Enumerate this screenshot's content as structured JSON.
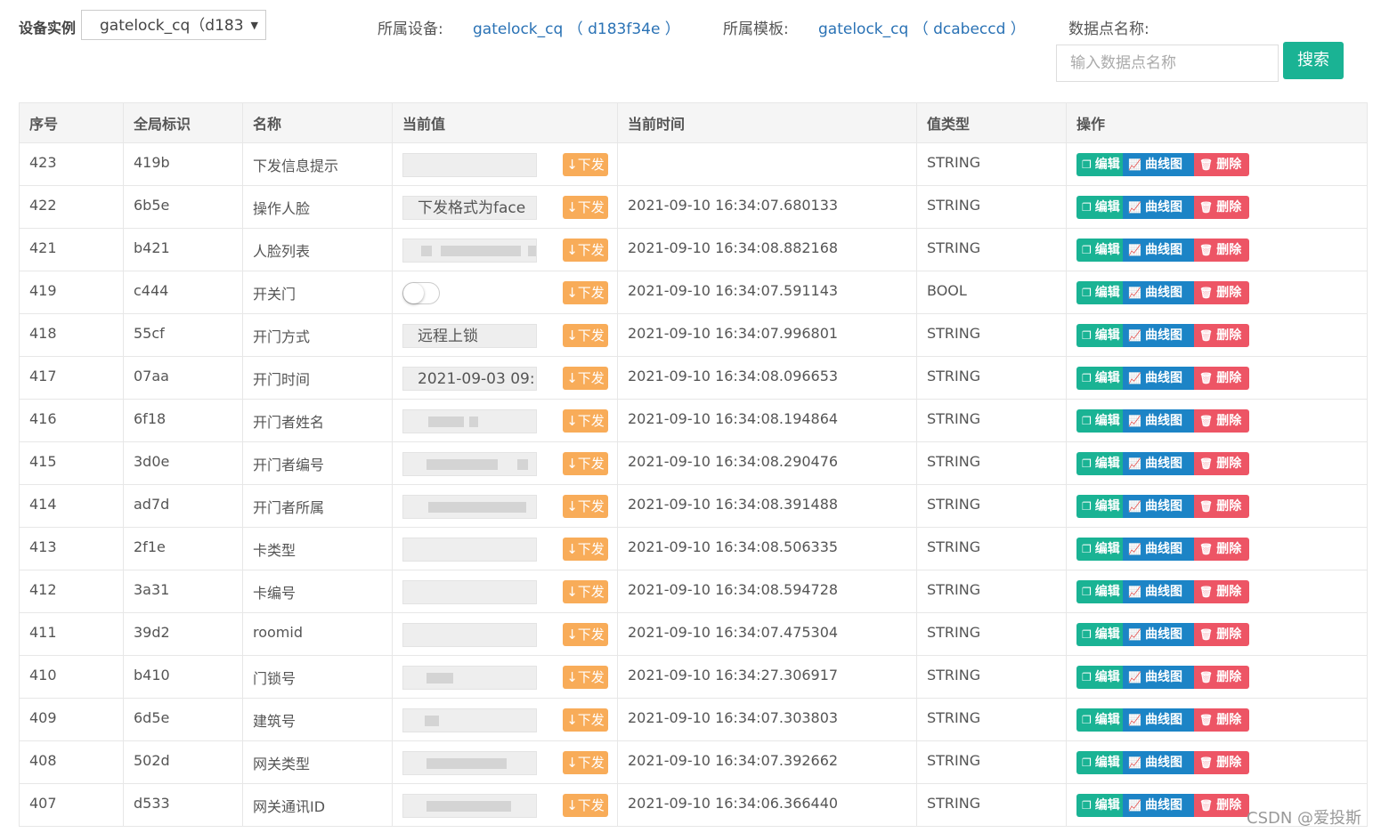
{
  "filters": {
    "instance_label": "设备实例",
    "instance_value": "gatelock_cq（d183",
    "device_label": "所属设备:",
    "device_value": "gatelock_cq （ d183f34e ）",
    "template_label": "所属模板:",
    "template_value": "gatelock_cq （ dcabeccd ）",
    "datapoint_label": "数据点名称:",
    "search_placeholder": "输入数据点名称",
    "search_button": "搜索"
  },
  "table": {
    "headers": [
      "序号",
      "全局标识",
      "名称",
      "当前值",
      "当前时间",
      "值类型",
      "操作"
    ],
    "send_label": "下发",
    "edit_label": "编辑",
    "chart_label": "曲线图",
    "delete_label": "删除",
    "rows": [
      {
        "no": "423",
        "gid": "419b",
        "name": "下发信息提示",
        "value": "",
        "time": "",
        "type": "STRING"
      },
      {
        "no": "422",
        "gid": "6b5e",
        "name": "操作人脸",
        "value": "下发格式为face",
        "time": "2021-09-10 16:34:07.680133",
        "type": "STRING"
      },
      {
        "no": "421",
        "gid": "b421",
        "name": "人脸列表",
        "value": "",
        "time": "2021-09-10 16:34:08.882168",
        "type": "STRING"
      },
      {
        "no": "419",
        "gid": "c444",
        "name": "开关门",
        "value": "",
        "time": "2021-09-10 16:34:07.591143",
        "type": "BOOL"
      },
      {
        "no": "418",
        "gid": "55cf",
        "name": "开门方式",
        "value": "远程上锁",
        "time": "2021-09-10 16:34:07.996801",
        "type": "STRING"
      },
      {
        "no": "417",
        "gid": "07aa",
        "name": "开门时间",
        "value": "2021-09-03 09:",
        "time": "2021-09-10 16:34:08.096653",
        "type": "STRING"
      },
      {
        "no": "416",
        "gid": "6f18",
        "name": "开门者姓名",
        "value": "",
        "time": "2021-09-10 16:34:08.194864",
        "type": "STRING"
      },
      {
        "no": "415",
        "gid": "3d0e",
        "name": "开门者编号",
        "value": "",
        "time": "2021-09-10 16:34:08.290476",
        "type": "STRING"
      },
      {
        "no": "414",
        "gid": "ad7d",
        "name": "开门者所属",
        "value": "",
        "time": "2021-09-10 16:34:08.391488",
        "type": "STRING"
      },
      {
        "no": "413",
        "gid": "2f1e",
        "name": "卡类型",
        "value": "",
        "time": "2021-09-10 16:34:08.506335",
        "type": "STRING"
      },
      {
        "no": "412",
        "gid": "3a31",
        "name": "卡编号",
        "value": "",
        "time": "2021-09-10 16:34:08.594728",
        "type": "STRING"
      },
      {
        "no": "411",
        "gid": "39d2",
        "name": "roomid",
        "value": "",
        "time": "2021-09-10 16:34:07.475304",
        "type": "STRING"
      },
      {
        "no": "410",
        "gid": "b410",
        "name": "门锁号",
        "value": "",
        "time": "2021-09-10 16:34:27.306917",
        "type": "STRING"
      },
      {
        "no": "409",
        "gid": "6d5e",
        "name": "建筑号",
        "value": "",
        "time": "2021-09-10 16:34:07.303803",
        "type": "STRING"
      },
      {
        "no": "408",
        "gid": "502d",
        "name": "网关类型",
        "value": "",
        "time": "2021-09-10 16:34:07.392662",
        "type": "STRING"
      },
      {
        "no": "407",
        "gid": "d533",
        "name": "网关通讯ID",
        "value": "",
        "time": "2021-09-10 16:34:06.366440",
        "type": "STRING"
      }
    ]
  },
  "watermark": "CSDN @爱投斯",
  "colors": {
    "primary": "#1ab394",
    "info": "#1c84c6",
    "danger": "#ed5565",
    "warning": "#f8ac59",
    "link": "#2a72b5"
  }
}
